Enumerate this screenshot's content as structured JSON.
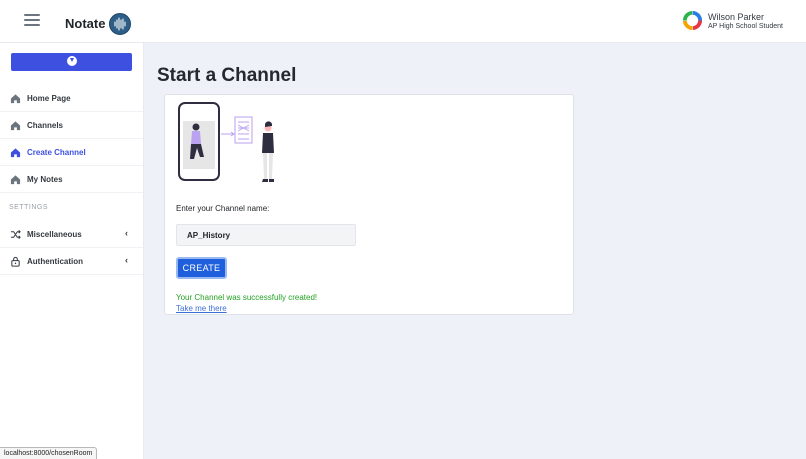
{
  "app": {
    "title": "Notate"
  },
  "user": {
    "name": "Wilson Parker",
    "role": "AP High School Student"
  },
  "sidebar": {
    "items": [
      {
        "label": "Home Page",
        "icon": "home-icon"
      },
      {
        "label": "Channels",
        "icon": "home-icon"
      },
      {
        "label": "Create Channel",
        "icon": "home-icon",
        "active": true
      },
      {
        "label": "My Notes",
        "icon": "home-icon"
      }
    ],
    "settings_header": "SETTINGS",
    "settings_items": [
      {
        "label": "Miscellaneous",
        "icon": "shuffle-icon"
      },
      {
        "label": "Authentication",
        "icon": "lock-icon"
      }
    ]
  },
  "main": {
    "title": "Start a Channel",
    "form": {
      "label": "Enter your Channel name:",
      "value": "AP_History",
      "button": "CREATE",
      "success": "Your Channel was successfully created!",
      "link": "Take me there"
    }
  },
  "status": {
    "url": "localhost:8000/chosenRoom"
  },
  "colors": {
    "accent": "#3d50e0",
    "button": "#1f5fdc",
    "success": "#24a324",
    "link": "#3d6fd6"
  }
}
